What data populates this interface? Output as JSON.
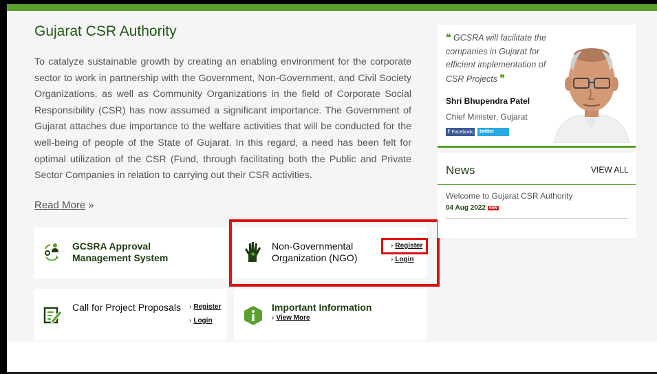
{
  "main": {
    "title": "Gujarat CSR Authority",
    "intro": "To catalyze sustainable growth by creating an enabling environment for the corporate sector to work in partnership with the Government, Non-Government, and Civil Society Organizations, as well as Community Organizations in the field of Corporate Social Responsibility (CSR) has now assumed a significant importance. The Government of Gujarat attaches due importance to the welfare activities that will be conducted for the well-being of people of the State of Gujarat. In this regard, a need has been felt for optimal utilization of the CSR (Fund, through facilitating both the Public and Private Sector Companies in relation to carrying out their CSR activities.",
    "read_more": "Read More",
    "read_more_arrow": "»"
  },
  "cards": {
    "gcsra": {
      "title_line1": "GCSRA Approval",
      "title_line2": "Management System",
      "icon": "people-cycle-icon"
    },
    "ngo": {
      "title_line1": "Non-Governmental",
      "title_line2": "Organization (NGO)",
      "register": "Register",
      "login": "Login",
      "icon": "hand-icon"
    },
    "proposals": {
      "title": "Call for Project Proposals",
      "register": "Register",
      "login": "Login",
      "icon": "edit-document-icon"
    },
    "info": {
      "title": "Important Information",
      "view_more": "View More",
      "icon": "info-icon"
    }
  },
  "chevron": "›",
  "quote": {
    "open_mark": "❝",
    "close_mark": "❞",
    "text": "GCSRA will facilitate the companies in Gujarat for efficient implementation of CSR Projects",
    "person_name": "Shri Bhupendra Patel",
    "person_role": "Chief Minister, Gujarat",
    "facebook_label": "Facebook",
    "twitter_label": "twitter"
  },
  "news": {
    "title": "News",
    "view_all": "VIEW ALL",
    "items": [
      {
        "text": "Welcome to Gujarat CSR Authority",
        "date": "04 Aug 2022",
        "badge": "new"
      }
    ]
  },
  "colors": {
    "accent_green": "#5aa02c",
    "dark_green": "#1e5a12",
    "highlight_red": "#e01010"
  }
}
